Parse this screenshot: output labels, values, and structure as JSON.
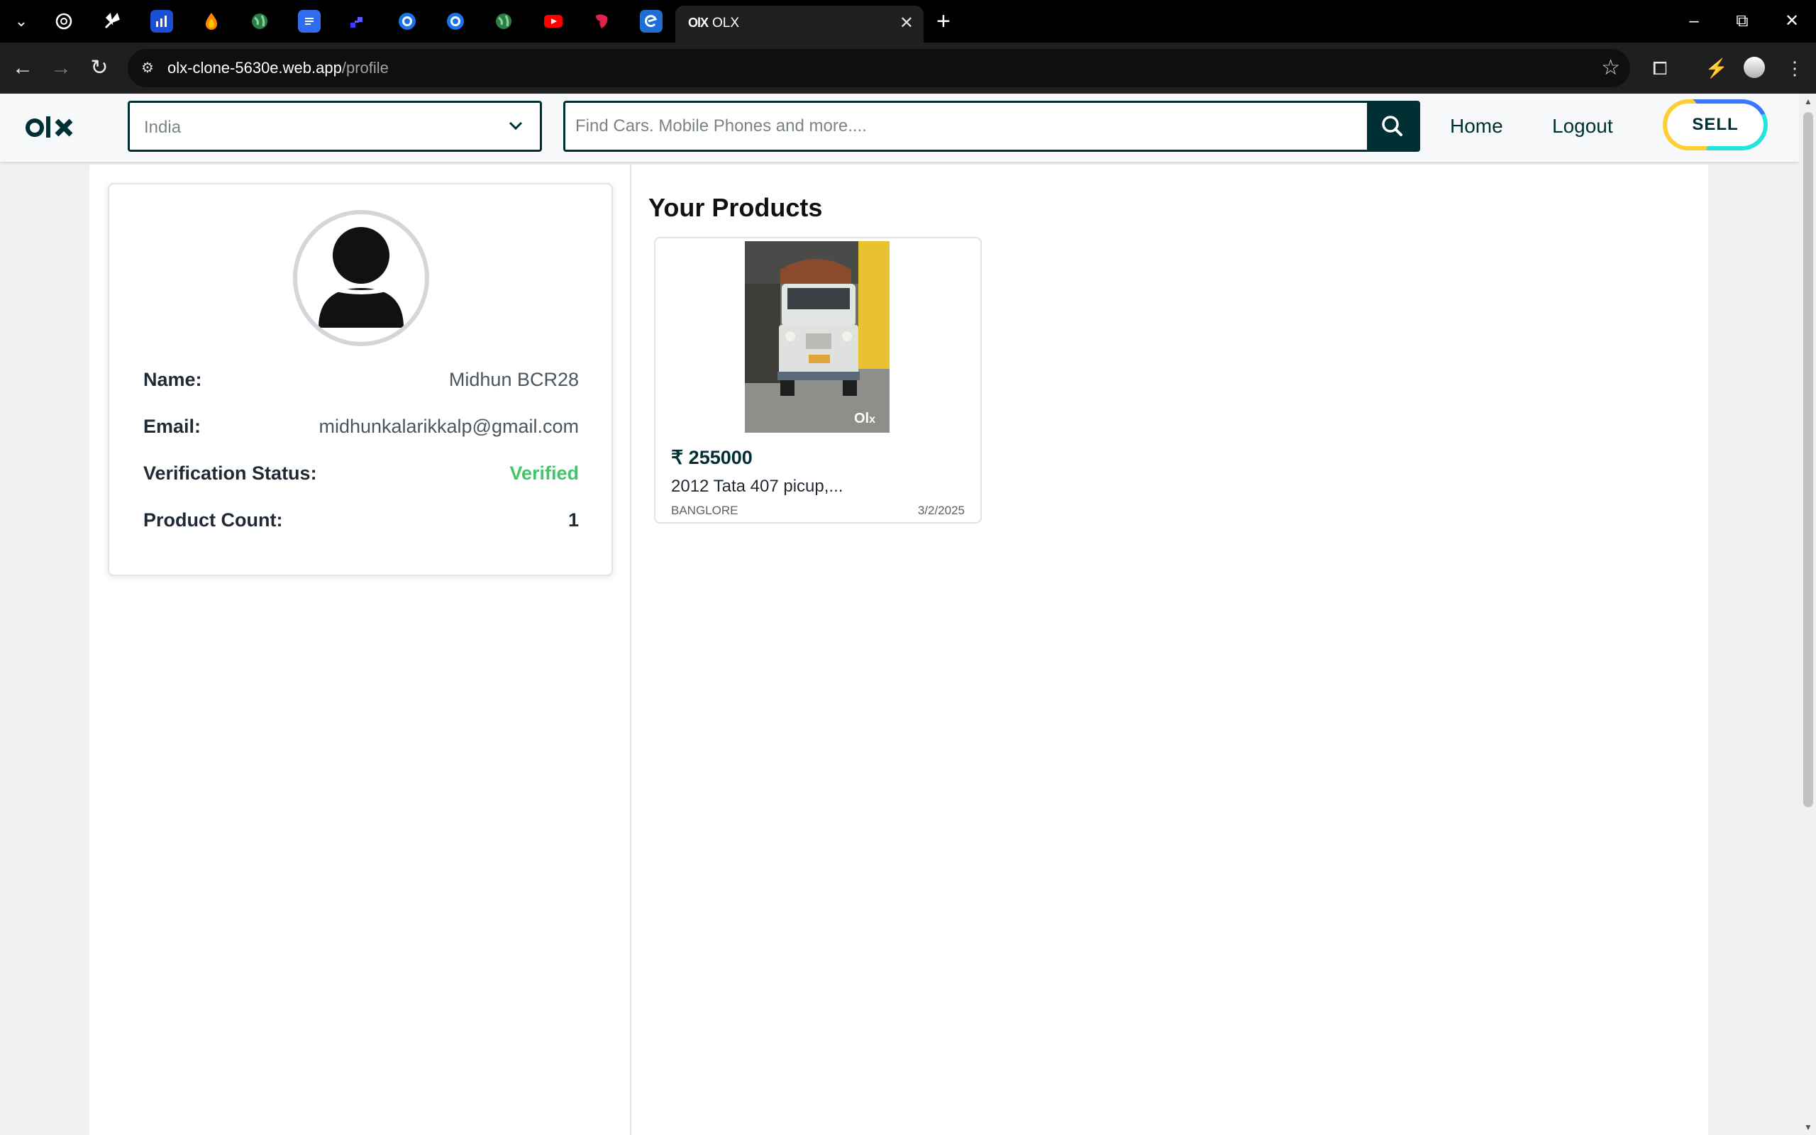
{
  "browser": {
    "pinned_tabs": [
      {
        "icon": "chatgpt-icon",
        "color": "#000000"
      },
      {
        "icon": "pinwheel-icon",
        "color": "#000000"
      },
      {
        "icon": "analytics-icon",
        "color": "#1a4fd6"
      },
      {
        "icon": "firebase-icon",
        "color": "#000000"
      },
      {
        "icon": "globe-icon",
        "color": "#000000"
      },
      {
        "icon": "docs-icon",
        "color": "#2f6cf0"
      },
      {
        "icon": "render-icon",
        "color": "#000000"
      },
      {
        "icon": "meet-icon",
        "color": "#1a73e8"
      },
      {
        "icon": "meet-icon",
        "color": "#1a73e8"
      },
      {
        "icon": "globe-icon",
        "color": "#000000"
      },
      {
        "icon": "youtube-icon",
        "color": "#ff0000"
      },
      {
        "icon": "nestjs-icon",
        "color": "#e0234e"
      },
      {
        "icon": "edge-icon",
        "color": "#1f6ed4"
      }
    ],
    "active_tab": {
      "title": "OLX",
      "favicon": "olx"
    },
    "url_host": "olx-clone-5630e.web.app",
    "url_path": "/profile"
  },
  "header": {
    "logo": "olx",
    "location_value": "India",
    "search_placeholder": "Find Cars. Mobile Phones and more....",
    "nav_home": "Home",
    "nav_logout": "Logout",
    "sell_label": "SELL",
    "colors": {
      "primary": "#002f34",
      "sell_yellow": "#ffce32",
      "sell_blue": "#3a77ff",
      "sell_cyan": "#23e5db"
    }
  },
  "profile": {
    "name_label": "Name:",
    "name_value": "Midhun BCR28",
    "email_label": "Email:",
    "email_value": "midhunkalarikkalp@gmail.com",
    "verification_label": "Verification Status:",
    "verification_value": "Verified",
    "count_label": "Product Count:",
    "count_value": "1",
    "verified_color": "#43c56b"
  },
  "products": {
    "title": "Your Products",
    "items": [
      {
        "price": "₹ 255000",
        "title": "2012 Tata 407 picup,...",
        "location": "BANGLORE",
        "date": "3/2/2025",
        "image_watermark": "olx"
      }
    ]
  }
}
